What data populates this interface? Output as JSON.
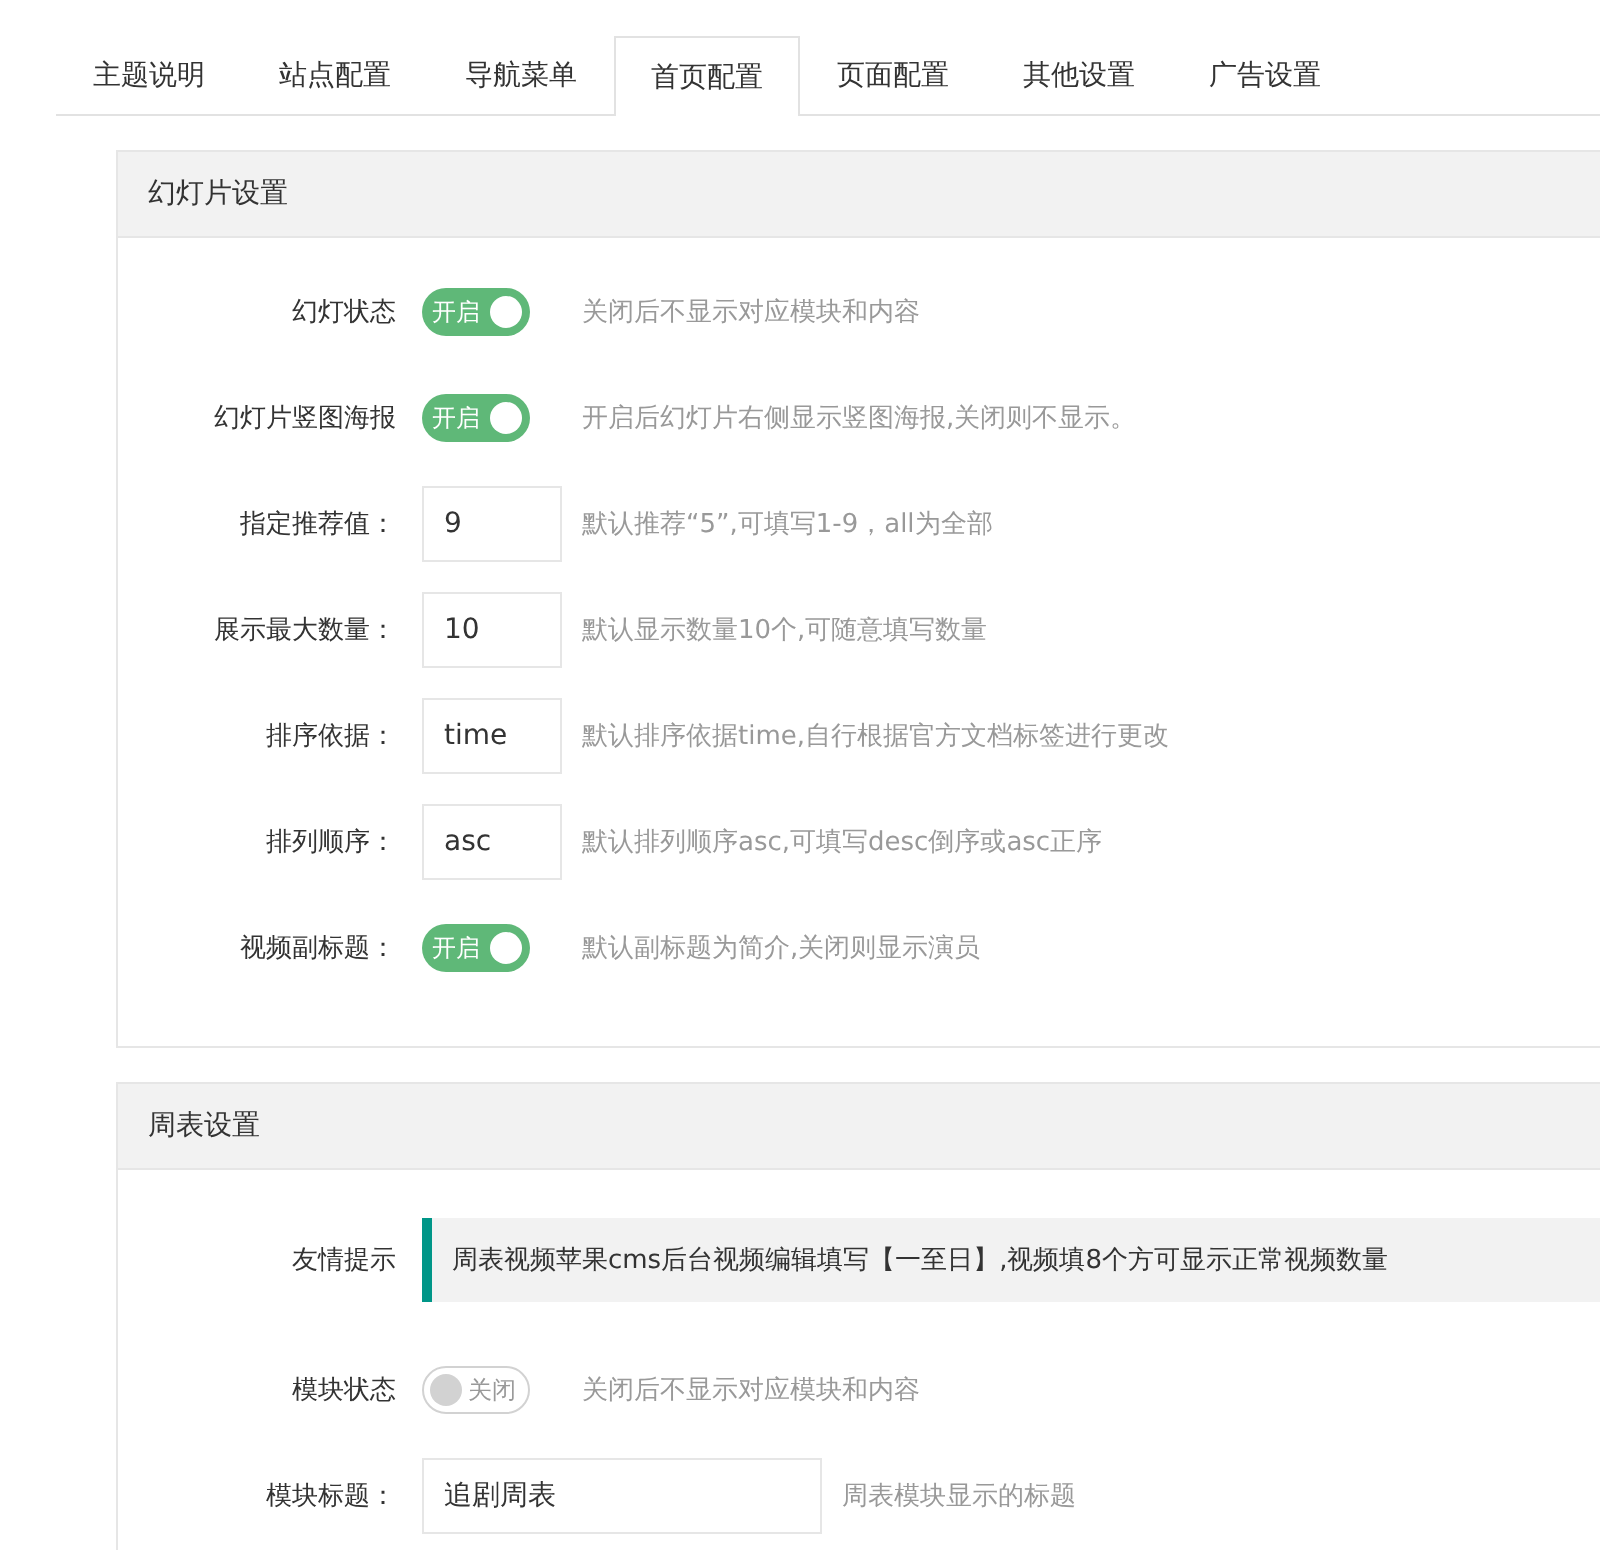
{
  "tabs": [
    {
      "label": "主题说明",
      "selected": false
    },
    {
      "label": "站点配置",
      "selected": false
    },
    {
      "label": "导航菜单",
      "selected": false
    },
    {
      "label": "首页配置",
      "selected": true
    },
    {
      "label": "页面配置",
      "selected": false
    },
    {
      "label": "其他设置",
      "selected": false
    },
    {
      "label": "广告设置",
      "selected": false
    }
  ],
  "sections": [
    {
      "title": "幻灯片设置",
      "rows": [
        {
          "kind": "toggle",
          "label": "幻灯状态",
          "on": true,
          "switch_text": "开启",
          "hint": "关闭后不显示对应模块和内容"
        },
        {
          "kind": "toggle",
          "label": "幻灯片竖图海报",
          "on": true,
          "switch_text": "开启",
          "hint": "开启后幻灯片右侧显示竖图海报,关闭则不显示。"
        },
        {
          "kind": "short_input",
          "label": "指定推荐值：",
          "value": "9",
          "hint": "默认推荐“5”,可填写1-9，all为全部"
        },
        {
          "kind": "short_input",
          "label": "展示最大数量：",
          "value": "10",
          "hint": "默认显示数量10个,可随意填写数量"
        },
        {
          "kind": "short_input",
          "label": "排序依据：",
          "value": "time",
          "hint": "默认排序依据time,自行根据官方文档标签进行更改"
        },
        {
          "kind": "short_input",
          "label": "排列顺序：",
          "value": "asc",
          "hint": "默认排列顺序asc,可填写desc倒序或asc正序"
        },
        {
          "kind": "toggle",
          "label": "视频副标题：",
          "on": true,
          "switch_text": "开启",
          "hint": "默认副标题为简介,关闭则显示演员"
        }
      ]
    },
    {
      "title": "周表设置",
      "rows": [
        {
          "kind": "tip",
          "label": "友情提示",
          "text": "周表视频苹果cms后台视频编辑填写【一至日】,视频填8个方可显示正常视频数量"
        },
        {
          "kind": "toggle",
          "label": "模块状态",
          "on": false,
          "switch_text": "关闭",
          "hint": "关闭后不显示对应模块和内容"
        },
        {
          "kind": "input",
          "label": "模块标题：",
          "value": "追剧周表",
          "hint": "周表模块显示的标题"
        }
      ]
    }
  ]
}
